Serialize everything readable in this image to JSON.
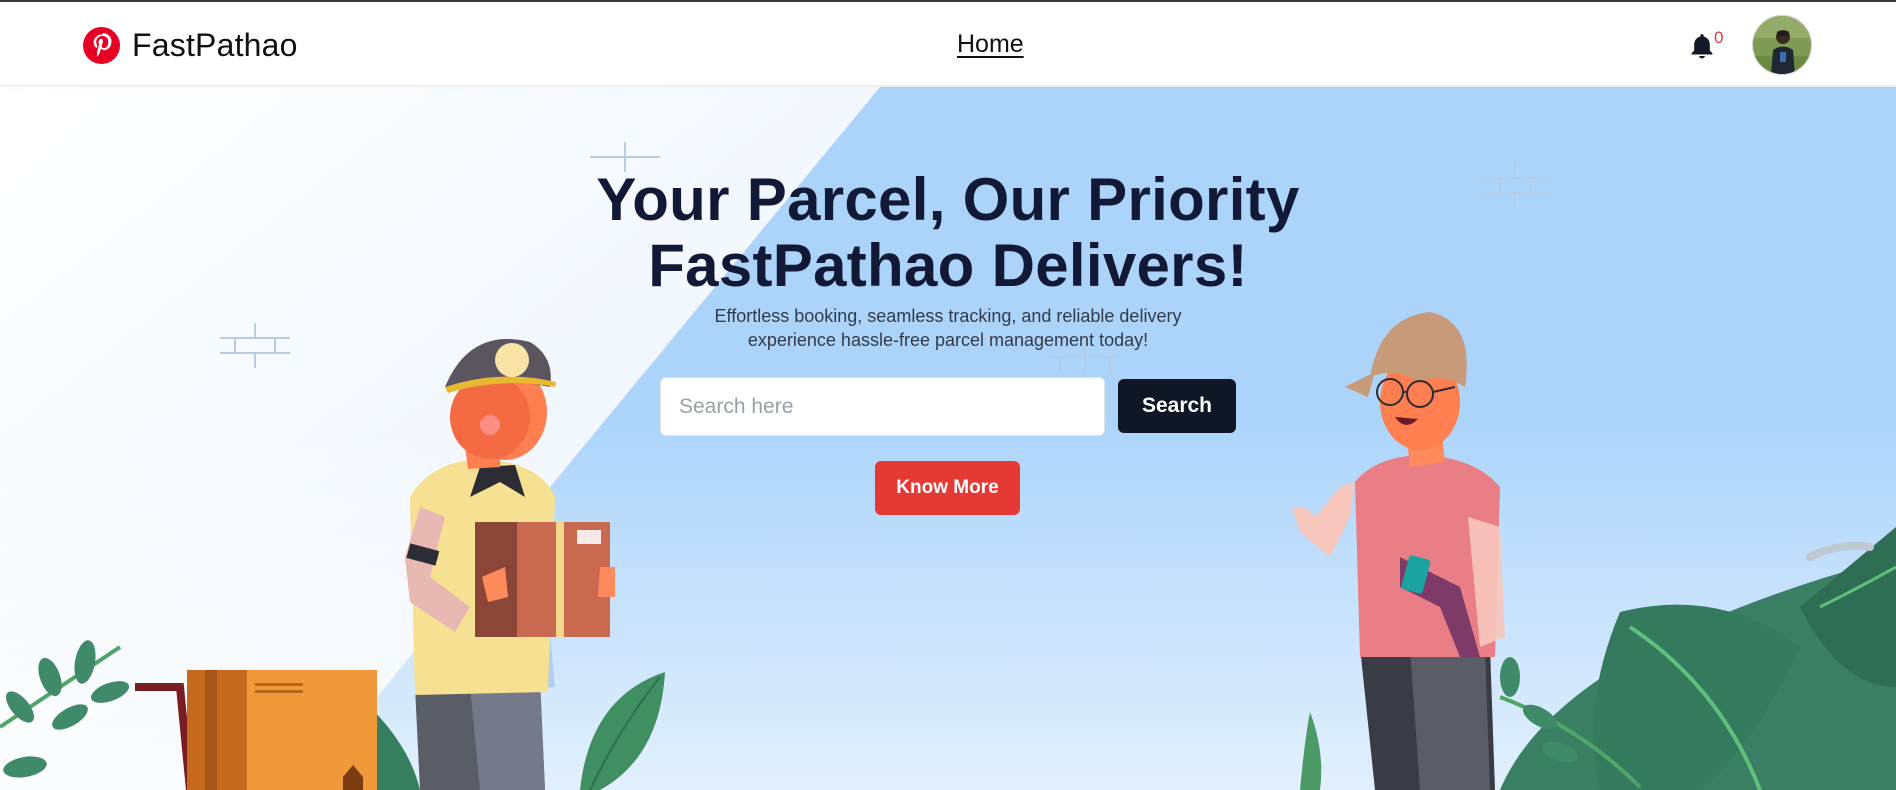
{
  "brand": {
    "name": "FastPathao",
    "icon": "pinterest-logo-icon",
    "color": "#e60023"
  },
  "nav": {
    "home_label": "Home"
  },
  "notifications": {
    "icon": "bell-icon",
    "count": "0"
  },
  "user": {
    "avatar": "user-avatar"
  },
  "hero": {
    "headline_line1": "Your Parcel, Our Priority",
    "headline_line2": "FastPathao Delivers!",
    "subtext_line1": "Effortless booking, seamless tracking, and reliable delivery",
    "subtext_line2": "experience hassle-free parcel management today!",
    "search_placeholder": "Search here",
    "search_value": "",
    "search_button": "Search",
    "cta_button": "Know More"
  },
  "colors": {
    "headline": "#111936",
    "search_button_bg": "#0f1626",
    "cta_bg": "#e53935",
    "hero_blue": "#acd4fb",
    "badge": "#e53935"
  }
}
